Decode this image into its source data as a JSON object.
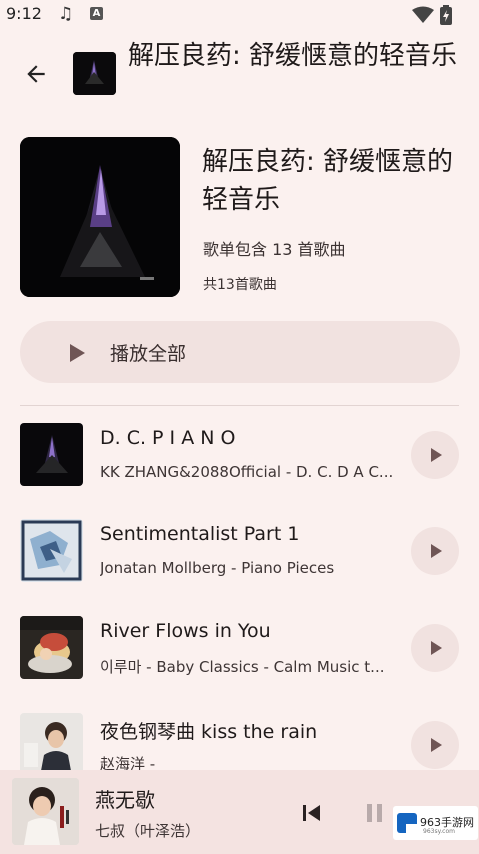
{
  "status": {
    "time": "9:12"
  },
  "header": {
    "title": "解压良药: 舒缓惬意的轻音乐"
  },
  "playlist": {
    "title": "解压良药: 舒缓惬意的轻音乐",
    "description": "歌单包含 13 首歌曲",
    "count": "共13首歌曲",
    "play_all_label": "播放全部"
  },
  "songs": [
    {
      "title": "D. C. P I A N O",
      "subtitle": "KK ZHANG&2088Official - D. C. D A C..."
    },
    {
      "title": "Sentimentalist Part 1",
      "subtitle": "Jonatan Mollberg - Piano Pieces"
    },
    {
      "title": "River Flows in You",
      "subtitle": "이루마 - Baby Classics - Calm Music t..."
    },
    {
      "title": "夜色钢琴曲 kiss the rain",
      "subtitle": "赵海洋 -"
    }
  ],
  "player": {
    "title": "燕无歇",
    "artist": "七叔（叶泽浩）"
  },
  "watermark": {
    "text": "963手游网",
    "sub": "963sy.com"
  },
  "colors": {
    "background": "#fbf1ef",
    "button": "#f1e2e0",
    "accent": "#6f5555"
  }
}
